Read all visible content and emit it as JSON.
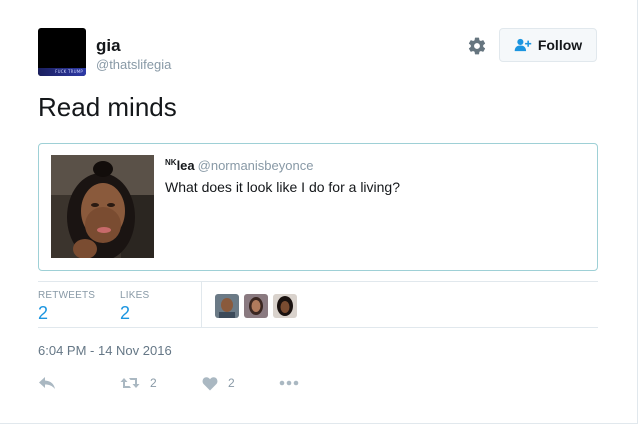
{
  "author": {
    "name": "gia",
    "handle": "@thatslifegia",
    "avatar_caption": "FUCK TRUMP"
  },
  "follow_label": "Follow",
  "tweet_text": "Read minds",
  "quote": {
    "name_prefix": "NK",
    "name": "lea",
    "handle": "@normanisbeyonce",
    "text": "What does it look like I do for a living?"
  },
  "stats": {
    "retweets_label": "RETWEETS",
    "retweets_count": "2",
    "likes_label": "LIKES",
    "likes_count": "2"
  },
  "timestamp": "6:04 PM - 14 Nov 2016",
  "actions": {
    "retweet_count": "2",
    "like_count": "2"
  },
  "colors": {
    "accent": "#1b95e0",
    "muted": "#8899a6",
    "quote_border": "#9ed0d6"
  },
  "icons": [
    "gear-icon",
    "follow-person-icon",
    "reply-icon",
    "retweet-icon",
    "heart-icon",
    "more-icon"
  ]
}
